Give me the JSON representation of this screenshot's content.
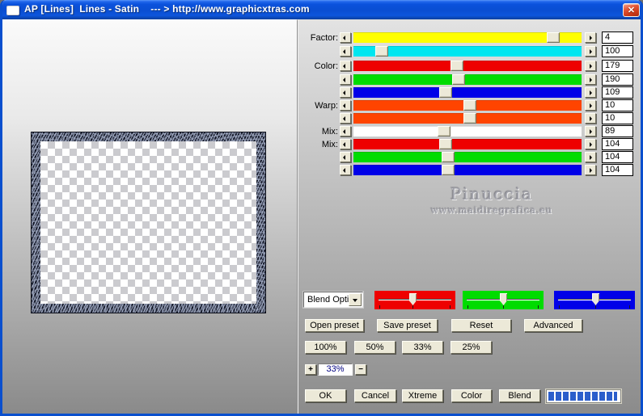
{
  "window": {
    "title": "AP [Lines]  Lines - Satin    --- > http://www.graphicxtras.com",
    "close_glyph": "✕"
  },
  "sliders": [
    {
      "label": "Factor:",
      "value": "4",
      "color": "#ffff00",
      "pos": 0.9
    },
    {
      "label": "",
      "value": "100",
      "color": "#00e6f0",
      "pos": 0.1
    },
    {
      "label": "Color:",
      "value": "179",
      "color": "#ee0000",
      "pos": 0.45
    },
    {
      "label": "",
      "value": "190",
      "color": "#00dc00",
      "pos": 0.46
    },
    {
      "label": "",
      "value": "109",
      "color": "#0000e8",
      "pos": 0.4
    },
    {
      "label": "Warp:",
      "value": "10",
      "color": "#ff4400",
      "pos": 0.51
    },
    {
      "label": "",
      "value": "10",
      "color": "#ff4400",
      "pos": 0.51
    },
    {
      "label": "Mix:",
      "value": "89",
      "color": "#ffffff",
      "pos": 0.39
    },
    {
      "label": "Mix:",
      "value": "104",
      "color": "#ee0000",
      "pos": 0.4
    },
    {
      "label": "",
      "value": "104",
      "color": "#00dc00",
      "pos": 0.41
    },
    {
      "label": "",
      "value": "104",
      "color": "#0000e8",
      "pos": 0.41
    }
  ],
  "watermark": {
    "name": "Pinuccia",
    "url": "www.maidiregrafica.eu"
  },
  "blend": {
    "dropdown_value": "Blend Opti",
    "trackbars": [
      {
        "name": "red-channel",
        "color": "#ee0000",
        "pos": 0.47
      },
      {
        "name": "green-channel",
        "color": "#00dc00",
        "pos": 0.5
      },
      {
        "name": "blue-channel",
        "color": "#0000e8",
        "pos": 0.52
      }
    ]
  },
  "preset_buttons": [
    "Open preset",
    "Save preset",
    "Reset",
    "Advanced"
  ],
  "percent_buttons": [
    "100%",
    "50%",
    "33%",
    "25%"
  ],
  "zoom_control": {
    "plus_label": "+",
    "value": "33%",
    "minus_label": "−"
  },
  "action_buttons": [
    "OK",
    "Cancel",
    "Xtreme",
    "Color",
    "Blend"
  ],
  "progress": {
    "segments": 10,
    "segment_color": "#2b5ecb"
  }
}
